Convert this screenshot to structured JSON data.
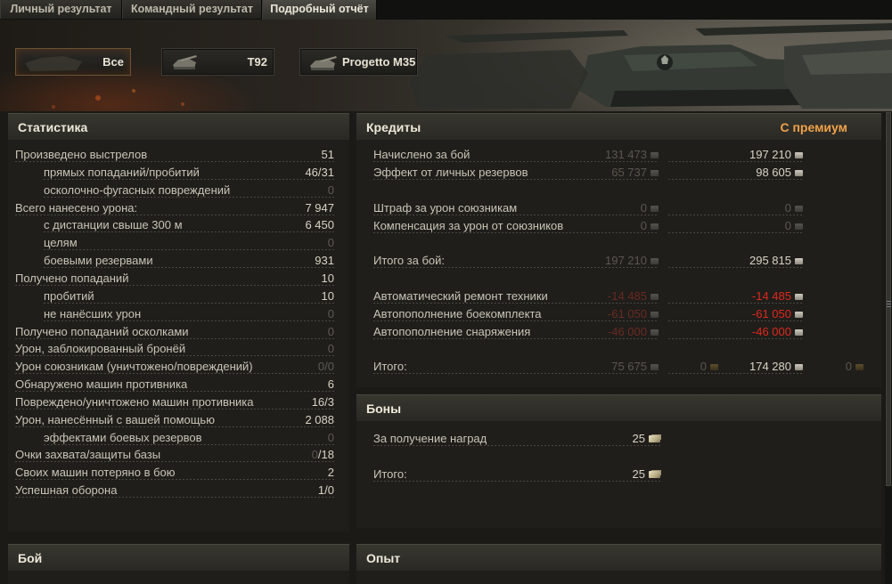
{
  "tabs": [
    {
      "label": "Личный результат",
      "active": false
    },
    {
      "label": "Командный результат",
      "active": false
    },
    {
      "label": "Подробный отчёт",
      "active": true
    }
  ],
  "vehicles": [
    {
      "label": "Все",
      "active": true,
      "icon": "all-vehicles-icon"
    },
    {
      "label": "T92",
      "active": false,
      "icon": "tank-icon"
    },
    {
      "label": "Progetto M35",
      "active": false,
      "icon": "tank-icon"
    }
  ],
  "stats": {
    "title": "Статистика",
    "rows": [
      {
        "label": "Произведено выстрелов",
        "value": "51",
        "indent": false,
        "dim": false
      },
      {
        "label": "прямых попаданий/пробитий",
        "value": "46/31",
        "indent": true,
        "dim": false
      },
      {
        "label": "осколочно-фугасных повреждений",
        "value": "0",
        "indent": true,
        "dim": true
      },
      {
        "label": "Всего нанесено урона:",
        "value": "7 947",
        "indent": false,
        "dim": false
      },
      {
        "label": "с дистанции свыше 300 м",
        "value": "6 450",
        "indent": true,
        "dim": false
      },
      {
        "label": "целям",
        "value": "0",
        "indent": true,
        "dim": true
      },
      {
        "label": "боевыми резервами",
        "value": "931",
        "indent": true,
        "dim": false
      },
      {
        "label": "Получено попаданий",
        "value": "10",
        "indent": false,
        "dim": false
      },
      {
        "label": "пробитий",
        "value": "10",
        "indent": true,
        "dim": false
      },
      {
        "label": "не нанёсших урон",
        "value": "0",
        "indent": true,
        "dim": true
      },
      {
        "label": "Получено попаданий осколками",
        "value": "0",
        "indent": false,
        "dim": true
      },
      {
        "label": "Урон, заблокированный бронёй",
        "value": "0",
        "indent": false,
        "dim": true
      },
      {
        "label": "Урон союзникам (уничтожено/повреждений)",
        "value": "0/0",
        "indent": false,
        "dim": true
      },
      {
        "label": "Обнаружено машин противника",
        "value": "6",
        "indent": false,
        "dim": false
      },
      {
        "label": "Повреждено/уничтожено машин противника",
        "value": "16/3",
        "indent": false,
        "dim": false
      },
      {
        "label": "Урон, нанесённый с вашей помощью",
        "value": "2 088",
        "indent": false,
        "dim": false
      },
      {
        "label": "эффектами боевых резервов",
        "value": "0",
        "indent": true,
        "dim": true
      },
      {
        "label": "Очки захвата/защиты базы",
        "value_dim": "0",
        "value": "/18",
        "indent": false,
        "dim": false
      },
      {
        "label": "Своих машин потеряно в бою",
        "value": "2",
        "indent": false,
        "dim": false
      },
      {
        "label": "Успешная оборона",
        "value": "1/0",
        "indent": false,
        "dim": false
      }
    ]
  },
  "credits": {
    "title": "Кредиты",
    "premium_label": "С премиум",
    "rows": [
      {
        "label": "Начислено за бой",
        "base": "131 473",
        "prem": "197 210",
        "style": "normal"
      },
      {
        "label": "Эффект от личных резервов",
        "base": "65 737",
        "prem": "98 605",
        "style": "normal"
      },
      {
        "label": "Штраф за урон союзникам",
        "base": "0",
        "prem": "0",
        "style": "zero"
      },
      {
        "label": "Компенсация за урон от союзников",
        "base": "0",
        "prem": "0",
        "style": "zero"
      },
      {
        "label": "Итого за бой:",
        "base": "197 210",
        "prem": "295 815",
        "style": "normal"
      },
      {
        "label": "Автоматический ремонт техники",
        "base": "-14 485",
        "prem": "-14 485",
        "style": "red"
      },
      {
        "label": "Автопополнение боекомплекта",
        "base": "-61 050",
        "prem": "-61 050",
        "style": "red"
      },
      {
        "label": "Автопополнение снаряжения",
        "base": "-46 000",
        "prem": "-46 000",
        "style": "red"
      },
      {
        "label": "Итого:",
        "base": "75 675",
        "base_gold": "0",
        "prem": "174 280",
        "prem_gold": "0",
        "style": "total"
      }
    ]
  },
  "bonds": {
    "title": "Боны",
    "rows": [
      {
        "label": "За получение наград",
        "value": "25"
      },
      {
        "label": "Итого:",
        "value": "25"
      }
    ]
  },
  "battle": {
    "title": "Бой"
  },
  "experience": {
    "title": "Опыт"
  }
}
